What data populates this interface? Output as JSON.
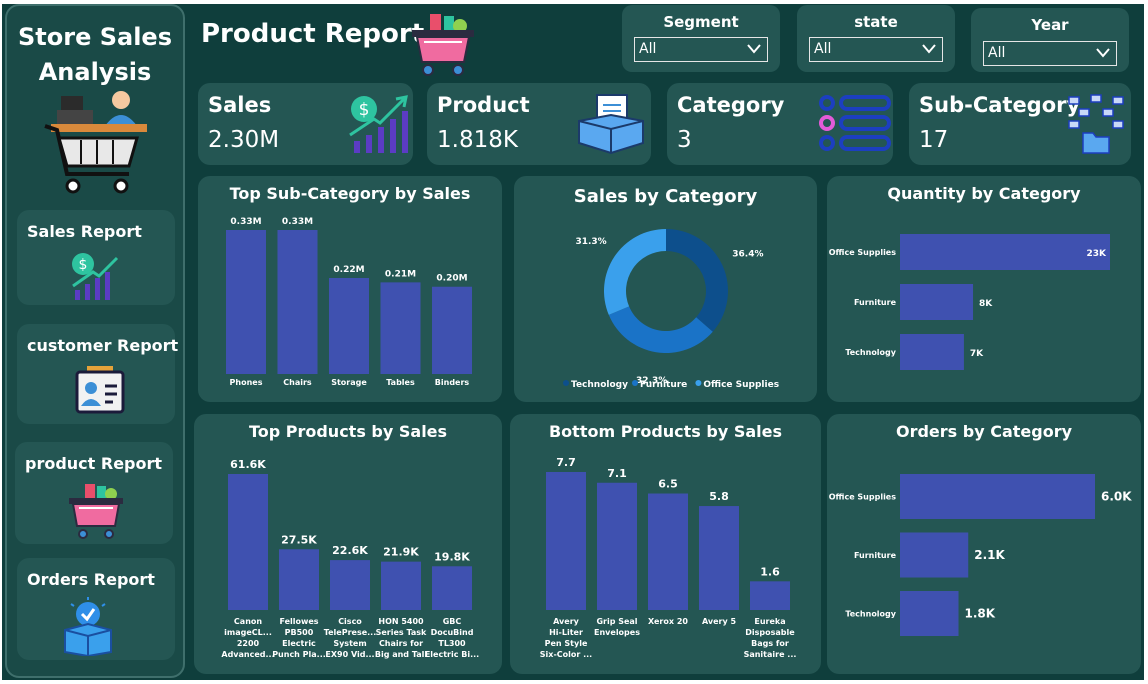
{
  "sidebar": {
    "title_line1": "Store Sales",
    "title_line2": "Analysis",
    "items": [
      {
        "label": "Sales Report"
      },
      {
        "label": "customer Report"
      },
      {
        "label": "product Report"
      },
      {
        "label": "Orders Report"
      }
    ]
  },
  "header": {
    "title": "Product Report"
  },
  "slicers": [
    {
      "label": "Segment",
      "value": "All"
    },
    {
      "label": "state",
      "value": "All"
    },
    {
      "label": "Year",
      "value": "All"
    }
  ],
  "cards": [
    {
      "label": "Sales",
      "value": "2.30M"
    },
    {
      "label": "Product",
      "value": "1.818K"
    },
    {
      "label": "Category",
      "value": "3"
    },
    {
      "label": "Sub-Category",
      "value": "17"
    }
  ],
  "colors": {
    "background": "#0f3e3c",
    "panel": "#245653",
    "bar": "#3f51b0",
    "donut_dark": "#0d4f8c",
    "donut_mid": "#1a73c7",
    "donut_light": "#3aa0ec"
  },
  "chart_data": [
    {
      "id": "top-subcat",
      "type": "bar",
      "title": "Top Sub-Category by Sales",
      "categories": [
        "Phones",
        "Chairs",
        "Storage",
        "Tables",
        "Binders"
      ],
      "values": [
        0.33,
        0.33,
        0.22,
        0.21,
        0.2
      ],
      "data_labels": [
        "0.33M",
        "0.33M",
        "0.22M",
        "0.21M",
        "0.20M"
      ]
    },
    {
      "id": "sales-by-cat",
      "type": "pie",
      "title": "Sales by Category",
      "labels": [
        "Technology",
        "Furniture",
        "Office Supplies"
      ],
      "values": [
        36.4,
        32.3,
        31.3
      ],
      "data_labels": [
        "36.4%",
        "32.3%",
        "31.3%"
      ],
      "legend": "bottom"
    },
    {
      "id": "qty-by-cat",
      "type": "bar",
      "title": "Quantity by Category",
      "orientation": "horizontal",
      "categories": [
        "Office Supplies",
        "Furniture",
        "Technology"
      ],
      "values": [
        23,
        8,
        7
      ],
      "data_labels": [
        "23K",
        "8K",
        "7K"
      ]
    },
    {
      "id": "top-products",
      "type": "bar",
      "title": "Top Products by Sales",
      "categories": [
        [
          "Canon",
          "imageCL...",
          "2200",
          "Advanced..."
        ],
        [
          "Fellowes",
          "PB500",
          "Electric",
          "Punch Pla..."
        ],
        [
          "Cisco",
          "TelePrese...",
          "System",
          "EX90 Vid..."
        ],
        [
          "HON 5400",
          "Series Task",
          "Chairs for",
          "Big and Tall"
        ],
        [
          "GBC",
          "DocuBind",
          "TL300",
          "Electric Bi..."
        ]
      ],
      "values": [
        61.6,
        27.5,
        22.6,
        21.9,
        19.8
      ],
      "data_labels": [
        "61.6K",
        "27.5K",
        "22.6K",
        "21.9K",
        "19.8K"
      ]
    },
    {
      "id": "bottom-products",
      "type": "bar",
      "title": "Bottom Products by Sales",
      "categories": [
        [
          "Avery",
          "Hi-Liter",
          "Pen Style",
          "Six-Color ..."
        ],
        [
          "Grip Seal",
          "Envelopes"
        ],
        [
          "Xerox 20"
        ],
        [
          "Avery 5"
        ],
        [
          "Eureka",
          "Disposable",
          "Bags for",
          "Sanitaire ..."
        ]
      ],
      "values": [
        7.7,
        7.1,
        6.5,
        5.8,
        1.6
      ],
      "data_labels": [
        "7.7",
        "7.1",
        "6.5",
        "5.8",
        "1.6"
      ]
    },
    {
      "id": "orders-by-cat",
      "type": "bar",
      "title": "Orders by Category",
      "orientation": "horizontal",
      "categories": [
        "Office Supplies",
        "Furniture",
        "Technology"
      ],
      "values": [
        6.0,
        2.1,
        1.8
      ],
      "data_labels": [
        "6.0K",
        "2.1K",
        "1.8K"
      ]
    }
  ]
}
